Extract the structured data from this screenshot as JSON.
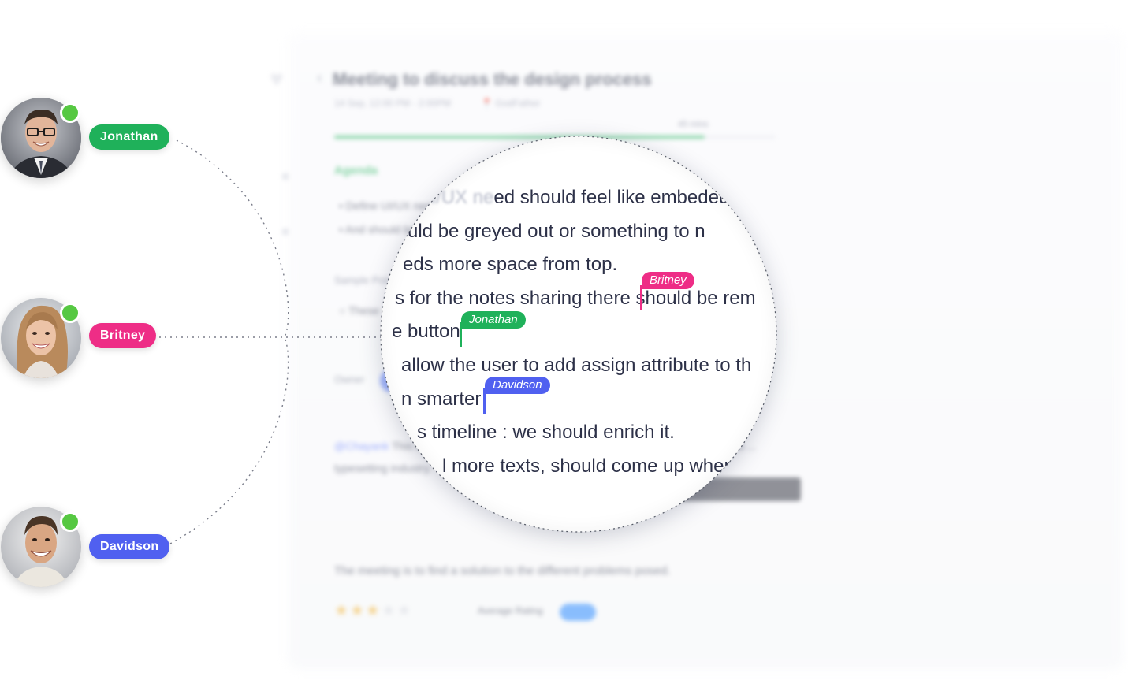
{
  "background_doc": {
    "title": "Meeting to discuss the design process",
    "date_time": "14 Sep, 12:00 PM - 2:00PM",
    "location": "GodFather",
    "progress_label": "45 mins",
    "progress_fraction": 0.84,
    "agenda_heading": "Agenda",
    "agenda_items": [
      "Define UI/UX need should feel like embeded",
      "And should be greyed out or something"
    ],
    "sample_heading": "Sample Points",
    "sample_item": "These",
    "owner_label": "Owner",
    "note_mention": "@Chayank",
    "note_text": "This is ... had more texts, should come up when placed by the shortlinks ... typesetting industry.",
    "conclusion": "The meeting is to find a solution to the different problems posed.",
    "rating_value": 3,
    "rating_max": 5,
    "average_rating_label": "Average Rating",
    "toggle_on": true
  },
  "collaborators": [
    {
      "name": "Jonathan",
      "color": "#1fb15a",
      "online": true
    },
    {
      "name": "Britney",
      "color": "#ee2d86",
      "online": true
    },
    {
      "name": "Davidson",
      "color": "#5060f0",
      "online": true
    }
  ],
  "magnifier": {
    "lines": [
      {
        "faded": "Define UI/UX ne",
        "text": "ed should feel like embeded u"
      },
      {
        "faded": "",
        "text": "uld be greyed out  or something to n"
      },
      {
        "faded": "",
        "text": "eds more space from top."
      },
      {
        "faded": "",
        "text": "s for the notes sharing there should be rem"
      },
      {
        "faded": "",
        "text": "e button"
      },
      {
        "faded": "",
        "text": "allow the user to add assign attribute to th"
      },
      {
        "faded": "",
        "text": "n smarter"
      },
      {
        "faded": "",
        "text": "s timeline : we should enrich it."
      },
      {
        "faded": "",
        "text": "l more texts,  should come up when"
      }
    ],
    "cursors": [
      {
        "name": "Britney",
        "color": "#ee2d86"
      },
      {
        "name": "Jonathan",
        "color": "#1fb15a"
      },
      {
        "name": "Davidson",
        "color": "#5060f0"
      }
    ]
  },
  "colors": {
    "online": "#56c842",
    "accent_green": "#22b35b",
    "accent_blue": "#2f8cff"
  }
}
